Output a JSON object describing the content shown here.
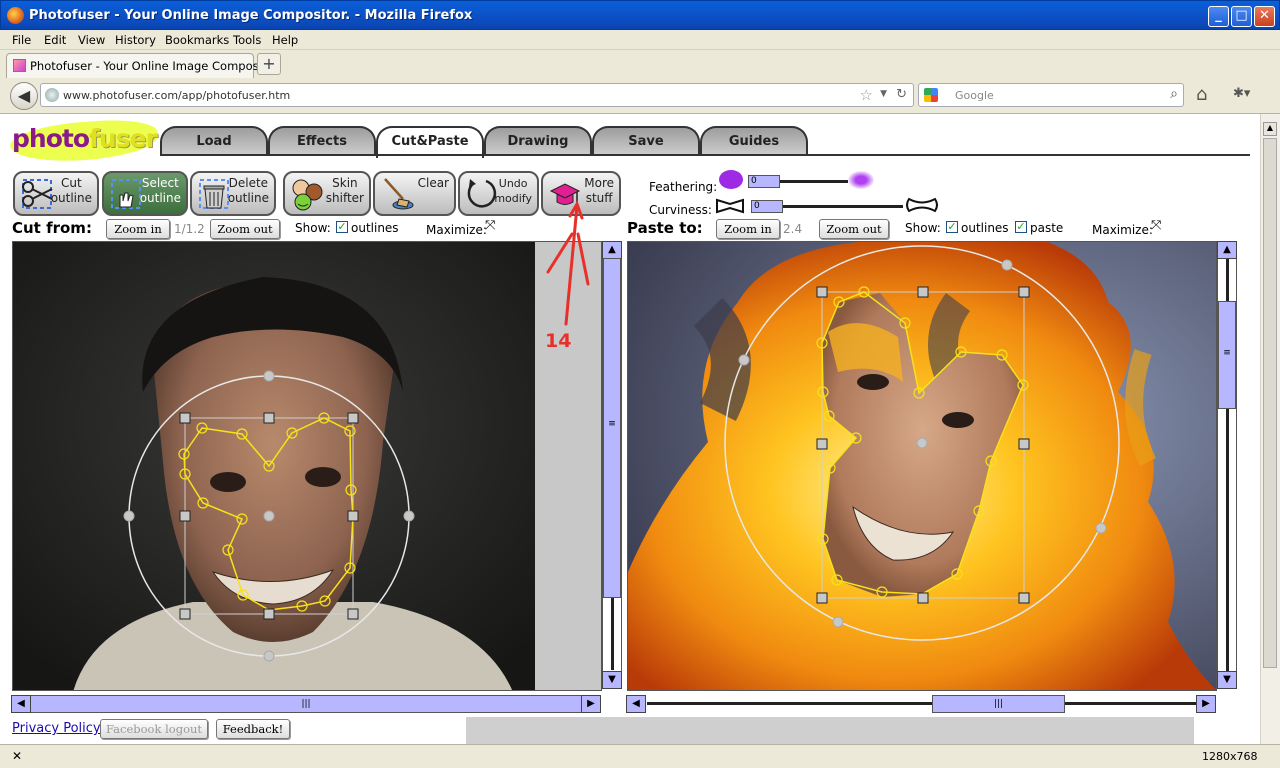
{
  "window": {
    "title": "Photofuser - Your Online Image Compositor. - Mozilla Firefox",
    "min": "_",
    "max": "□",
    "close": "✕"
  },
  "menu": [
    "File",
    "Edit",
    "View",
    "History",
    "Bookmarks",
    "Tools",
    "Help"
  ],
  "browser_tab": {
    "title": "Photofuser - Your Online Image Compositor.",
    "new_tab": "+"
  },
  "nav": {
    "url": "www.photofuser.com/app/photofuser.htm",
    "search_placeholder": "Google",
    "back": "◀"
  },
  "app": {
    "logo_a": "photo",
    "logo_b": "fuser",
    "tabs": [
      "Load",
      "Effects",
      "Cut&Paste",
      "Drawing",
      "Save",
      "Guides"
    ],
    "active_tab": "Cut&Paste",
    "tools": [
      {
        "label": "Cut\noutline"
      },
      {
        "label": "Select\noutline"
      },
      {
        "label": "Delete\noutline"
      },
      {
        "label": "Skin\nshifter"
      },
      {
        "label": "Clear"
      },
      {
        "label": "Undo\nmodify"
      },
      {
        "label": "More\nstuff"
      }
    ],
    "feathering": {
      "label": "Feathering:",
      "value": "0"
    },
    "curviness": {
      "label": "Curviness:",
      "value": "0"
    },
    "annotation": "14",
    "cut": {
      "title": "Cut from:",
      "zoom_in": "Zoom in",
      "zoom_level": "1/1.2",
      "zoom_out": "Zoom out",
      "show": "Show:",
      "outlines": "outlines",
      "maximize": "Maximize:"
    },
    "paste": {
      "title": "Paste to:",
      "zoom_in": "Zoom in",
      "zoom_level": "2.4",
      "zoom_out": "Zoom out",
      "show": "Show:",
      "outlines": "outlines",
      "paste": "paste",
      "maximize": "Maximize:"
    },
    "footer": {
      "privacy": "Privacy Policy",
      "fb_logout": "Facebook logout",
      "feedback": "Feedback!"
    }
  },
  "status": {
    "close": "✕",
    "resolution": "1280x768"
  },
  "colors": {
    "title_blue": "#0a5fd8",
    "selected_tool": "#4a7c4a",
    "scroll_purple": "#b7b7ff",
    "annotation_red": "#e8302a"
  }
}
